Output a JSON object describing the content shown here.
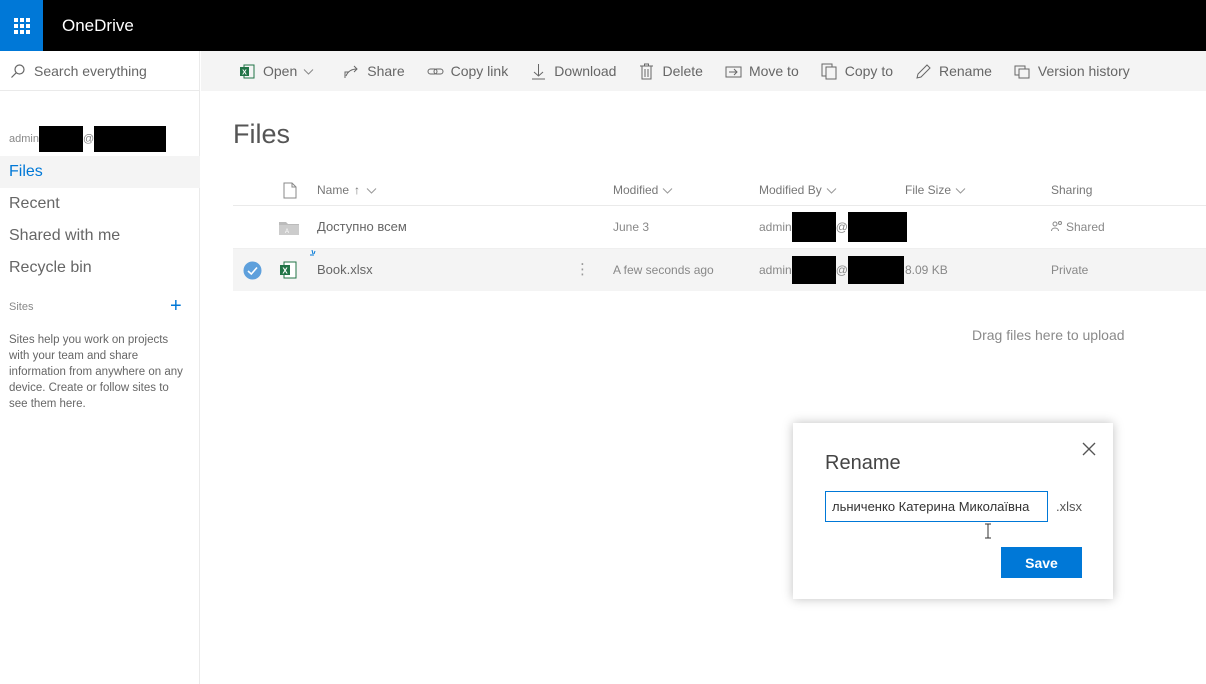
{
  "topbar": {
    "app_title": "OneDrive"
  },
  "leftnav": {
    "search_placeholder": "Search everything",
    "account_prefix": "admin",
    "account_at": "@",
    "items": [
      {
        "label": "Files",
        "active": true
      },
      {
        "label": "Recent"
      },
      {
        "label": "Shared with me"
      },
      {
        "label": "Recycle bin"
      }
    ],
    "sites_heading": "Sites",
    "sites_add": "+",
    "sites_text": "Sites help you work on projects with your team and share information from anywhere on any device. Create or follow sites to see them here."
  },
  "commandbar": {
    "open": "Open",
    "share": "Share",
    "copy_link": "Copy link",
    "download": "Download",
    "delete": "Delete",
    "move_to": "Move to",
    "copy_to": "Copy to",
    "rename": "Rename",
    "version_history": "Version history"
  },
  "main": {
    "title": "Files",
    "columns": {
      "name": "Name",
      "sort_arrow": "↑",
      "modified": "Modified",
      "modified_by": "Modified By",
      "file_size": "File Size",
      "sharing": "Sharing"
    },
    "rows": [
      {
        "name": "Доступно всем",
        "type": "folder",
        "modified": "June 3",
        "modified_by_prefix": "admin",
        "modified_by_at": "@",
        "file_size": "",
        "sharing": "Shared",
        "selected": false
      },
      {
        "name": "Book.xlsx",
        "type": "excel",
        "modified": "A few seconds ago",
        "modified_by_prefix": "admin",
        "modified_by_at": "@",
        "file_size": "8.09 KB",
        "sharing": "Private",
        "selected": true
      }
    ],
    "more_glyph": "⋮",
    "drag_hint": "Drag files here to upload"
  },
  "dialog": {
    "title": "Rename",
    "input_value": "льниченко Катерина Миколаївна",
    "extension": ".xlsx",
    "save_label": "Save"
  },
  "colors": {
    "accent": "#0078d7",
    "topbar": "#000000",
    "excel": "#217346"
  }
}
